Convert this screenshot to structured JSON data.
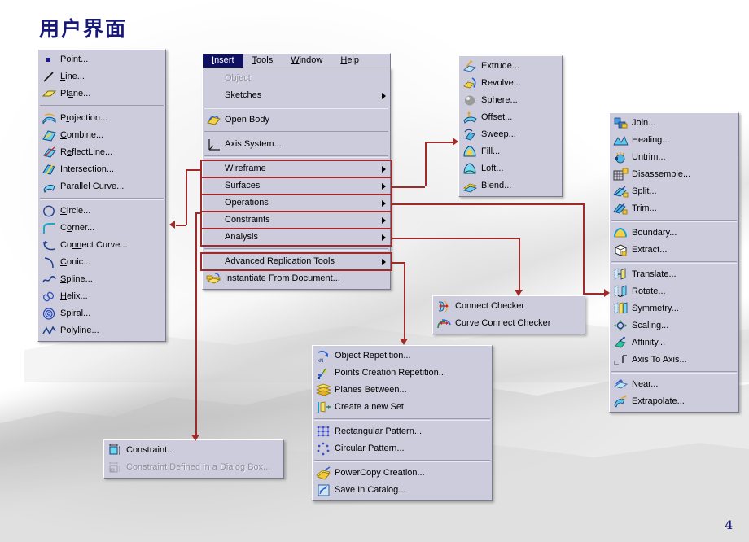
{
  "slide": {
    "title": "用户界面",
    "page_number": "4"
  },
  "colors": {
    "title": "#181878",
    "highlight": "#9e2a2a",
    "menu_bg": "#ccccdd",
    "menubar_selected": "#101060"
  },
  "left_panel": {
    "name": "wireframe-toolbar-menu",
    "groups": [
      [
        {
          "label": "Point...",
          "icon": "point-icon",
          "accel": "P"
        },
        {
          "label": "Line...",
          "icon": "line-icon",
          "accel": "L"
        },
        {
          "label": "Plane...",
          "icon": "plane-icon",
          "accel": "a"
        }
      ],
      [
        {
          "label": "Projection...",
          "icon": "projection-icon",
          "accel": "r"
        },
        {
          "label": "Combine...",
          "icon": "combine-icon",
          "accel": "C"
        },
        {
          "label": "ReflectLine...",
          "icon": "reflectline-icon",
          "accel": "e"
        },
        {
          "label": "Intersection...",
          "icon": "intersection-icon",
          "accel": "I"
        },
        {
          "label": "Parallel Curve...",
          "icon": "parallel-curve-icon",
          "accel": "u"
        }
      ],
      [
        {
          "label": "Circle...",
          "icon": "circle-icon",
          "accel": "C"
        },
        {
          "label": "Corner...",
          "icon": "corner-icon",
          "accel": "o"
        },
        {
          "label": "Connect Curve...",
          "icon": "connect-curve-icon",
          "accel": "nn"
        },
        {
          "label": "Conic...",
          "icon": "conic-icon",
          "accel": "C"
        },
        {
          "label": "Spline...",
          "icon": "spline-icon",
          "accel": "S"
        },
        {
          "label": "Helix...",
          "icon": "helix-icon",
          "accel": "H"
        },
        {
          "label": "Spiral...",
          "icon": "spiral-icon",
          "accel": "S"
        },
        {
          "label": "Polyline...",
          "icon": "polyline-icon",
          "accel": "yl"
        }
      ]
    ]
  },
  "menubar": {
    "name": "application-menubar",
    "items": [
      {
        "label": "Insert",
        "selected": true
      },
      {
        "label": "Tools",
        "selected": false
      },
      {
        "label": "Window",
        "selected": false
      },
      {
        "label": "Help",
        "selected": false
      }
    ]
  },
  "insert_menu": {
    "name": "insert-menu",
    "groups": [
      [
        {
          "label": "Object",
          "icon": "none",
          "disabled": true,
          "submenu": false
        },
        {
          "label": "Sketches",
          "icon": "none",
          "disabled": false,
          "submenu": true
        }
      ],
      [
        {
          "label": "Open Body",
          "icon": "open-body-icon",
          "disabled": false,
          "submenu": false
        }
      ],
      [
        {
          "label": "Axis System...",
          "icon": "axis-system-icon",
          "disabled": false,
          "submenu": false
        }
      ],
      [
        {
          "label": "Wireframe",
          "icon": "none",
          "disabled": false,
          "submenu": true,
          "highlight": true
        },
        {
          "label": "Surfaces",
          "icon": "none",
          "disabled": false,
          "submenu": true,
          "highlight": true
        },
        {
          "label": "Operations",
          "icon": "none",
          "disabled": false,
          "submenu": true,
          "highlight": true
        },
        {
          "label": "Constraints",
          "icon": "none",
          "disabled": false,
          "submenu": true,
          "highlight": true
        },
        {
          "label": "Analysis",
          "icon": "none",
          "disabled": false,
          "submenu": true,
          "highlight": true
        }
      ],
      [
        {
          "label": "Advanced Replication Tools",
          "icon": "none",
          "disabled": false,
          "submenu": true,
          "highlight": true
        },
        {
          "label": "Instantiate From Document...",
          "icon": "instantiate-icon",
          "disabled": false,
          "submenu": false
        }
      ]
    ]
  },
  "surfaces_menu": {
    "name": "surfaces-submenu",
    "items": [
      {
        "label": "Extrude...",
        "icon": "extrude-icon"
      },
      {
        "label": "Revolve...",
        "icon": "revolve-icon"
      },
      {
        "label": "Sphere...",
        "icon": "sphere-icon"
      },
      {
        "label": "Offset...",
        "icon": "offset-icon"
      },
      {
        "label": "Sweep...",
        "icon": "sweep-icon"
      },
      {
        "label": "Fill...",
        "icon": "fill-icon"
      },
      {
        "label": "Loft...",
        "icon": "loft-icon"
      },
      {
        "label": "Blend...",
        "icon": "blend-icon"
      }
    ]
  },
  "operations_menu": {
    "name": "operations-submenu",
    "groups": [
      [
        {
          "label": "Join...",
          "icon": "join-icon"
        },
        {
          "label": "Healing...",
          "icon": "healing-icon"
        },
        {
          "label": "Untrim...",
          "icon": "untrim-icon"
        },
        {
          "label": "Disassemble...",
          "icon": "disassemble-icon"
        },
        {
          "label": "Split...",
          "icon": "split-icon"
        },
        {
          "label": "Trim...",
          "icon": "trim-icon"
        }
      ],
      [
        {
          "label": "Boundary...",
          "icon": "boundary-icon"
        },
        {
          "label": "Extract...",
          "icon": "extract-icon"
        }
      ],
      [
        {
          "label": "Translate...",
          "icon": "translate-icon"
        },
        {
          "label": "Rotate...",
          "icon": "rotate-icon"
        },
        {
          "label": "Symmetry...",
          "icon": "symmetry-icon"
        },
        {
          "label": "Scaling...",
          "icon": "scaling-icon"
        },
        {
          "label": "Affinity...",
          "icon": "affinity-icon"
        },
        {
          "label": "Axis To Axis...",
          "icon": "axis-to-axis-icon"
        }
      ],
      [
        {
          "label": "Near...",
          "icon": "near-icon"
        },
        {
          "label": "Extrapolate...",
          "icon": "extrapolate-icon"
        }
      ]
    ]
  },
  "analysis_menu": {
    "name": "analysis-submenu",
    "items": [
      {
        "label": "Connect Checker",
        "icon": "connect-checker-icon"
      },
      {
        "label": "Curve Connect Checker",
        "icon": "curve-connect-checker-icon"
      }
    ]
  },
  "advanced_replication_menu": {
    "name": "advanced-replication-tools-submenu",
    "groups": [
      [
        {
          "label": "Object Repetition...",
          "icon": "object-repetition-icon"
        },
        {
          "label": "Points Creation Repetition...",
          "icon": "points-creation-repetition-icon"
        },
        {
          "label": "Planes Between...",
          "icon": "planes-between-icon"
        },
        {
          "label": "Create a new Set",
          "icon": "create-new-set-icon"
        }
      ],
      [
        {
          "label": "Rectangular Pattern...",
          "icon": "rectangular-pattern-icon"
        },
        {
          "label": "Circular Pattern...",
          "icon": "circular-pattern-icon"
        }
      ],
      [
        {
          "label": "PowerCopy Creation...",
          "icon": "powercopy-creation-icon"
        },
        {
          "label": "Save In Catalog...",
          "icon": "save-in-catalog-icon"
        }
      ]
    ]
  },
  "constraints_menu": {
    "name": "constraints-submenu",
    "items": [
      {
        "label": "Constraint...",
        "icon": "constraint-icon",
        "disabled": false
      },
      {
        "label": "Constraint Defined in a Dialog Box...",
        "icon": "constraint-dialog-icon",
        "disabled": true
      }
    ]
  }
}
